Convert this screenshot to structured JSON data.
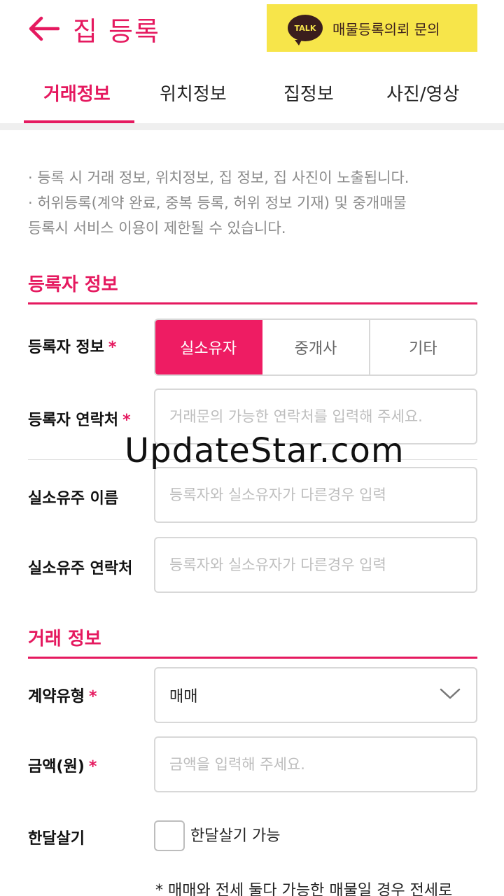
{
  "header": {
    "title": "집 등록",
    "kakao_badge": "TALK",
    "kakao_button_label": "매물등록의뢰 문의"
  },
  "tabs": [
    {
      "label": "거래정보",
      "active": true
    },
    {
      "label": "위치정보",
      "active": false
    },
    {
      "label": "집정보",
      "active": false
    },
    {
      "label": "사진/영상",
      "active": false
    }
  ],
  "notice": {
    "line1": "· 등록 시 거래 정보, 위치정보, 집 정보, 집 사진이 노출됩니다.",
    "line2": "· 허위등록(계약 완료, 중복 등록, 허위 정보 기재) 및 중개매물",
    "line3": "등록시 서비스 이용이 제한될 수 있습니다."
  },
  "registrant_section": {
    "title": "등록자 정보",
    "type_label": "등록자 정보",
    "type_options": [
      {
        "label": "실소유자",
        "selected": true
      },
      {
        "label": "중개사",
        "selected": false
      },
      {
        "label": "기타",
        "selected": false
      }
    ],
    "contact_label": "등록자 연락처",
    "contact_placeholder": "거래문의 가능한 연락처를 입력해 주세요.",
    "owner_name_label": "실소유주 이름",
    "owner_name_placeholder": "등록자와 실소유자가 다른경우 입력",
    "owner_contact_label": "실소유주 연락처",
    "owner_contact_placeholder": "등록자와 실소유자가 다른경우 입력",
    "required_mark": "*"
  },
  "deal_section": {
    "title": "거래 정보",
    "contract_type_label": "계약유형",
    "contract_type_value": "매매",
    "price_label": "금액(원)",
    "price_placeholder": "금액을 입력해 주세요.",
    "monthly_label": "한달살기",
    "monthly_checkbox_label": "한달살기 가능",
    "monthly_checked": false,
    "footnote": "* 매매와 전세 둘다 가능한 매물일 경우 전세로"
  },
  "watermark": "UpdateStar.com",
  "colors": {
    "accent": "#e5195f",
    "kakao_yellow": "#f7e54a",
    "kakao_brown": "#3a1d1d"
  }
}
